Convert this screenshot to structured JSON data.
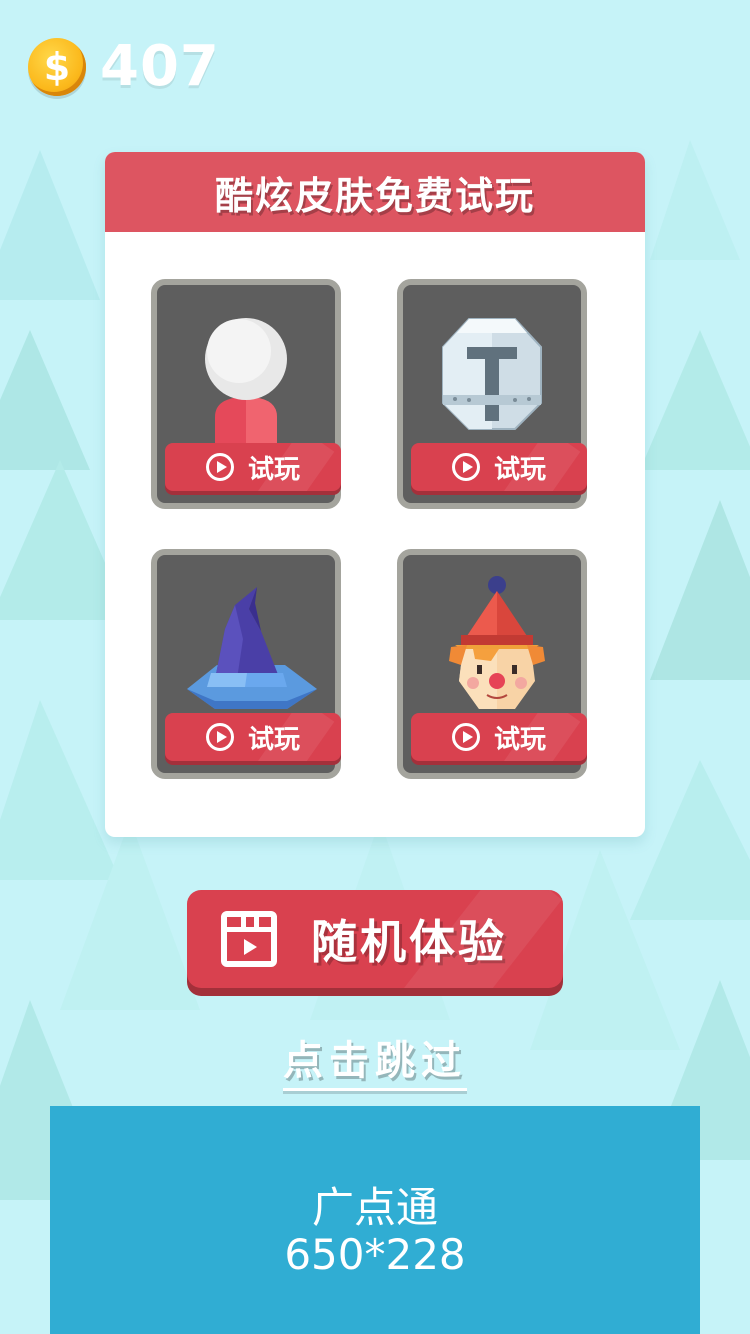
{
  "hud": {
    "coins": "407",
    "coin_symbol": "$"
  },
  "panel": {
    "title": "酷炫皮肤免费试玩",
    "skins": [
      {
        "icon": "stickman-avatar-icon",
        "try_label": "试玩"
      },
      {
        "icon": "knight-helmet-icon",
        "try_label": "试玩"
      },
      {
        "icon": "wizard-hat-icon",
        "try_label": "试玩"
      },
      {
        "icon": "clown-face-icon",
        "try_label": "试玩"
      }
    ]
  },
  "random_button": {
    "label": "随机体验",
    "icon": "film-icon"
  },
  "skip": {
    "label": "点击跳过"
  },
  "ad": {
    "line1": "广点通",
    "line2": "650*228"
  },
  "colors": {
    "background": "#c6f3f8",
    "accent_red": "#d9414f",
    "header_red": "#dd5561",
    "ad_blue": "#30add3",
    "coin_gold": "#fbb81b"
  }
}
